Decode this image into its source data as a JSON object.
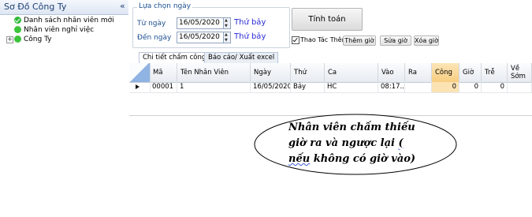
{
  "sidebar": {
    "title": "Sơ Đồ Công Ty",
    "collapse_icon": "«",
    "items": [
      {
        "label": "Danh sách nhân viên mới",
        "icon": "check-circle-icon"
      },
      {
        "label": "Nhân viên nghỉ việc",
        "icon": "green-dot-icon"
      },
      {
        "label": "Công Ty",
        "icon": "green-dot-icon",
        "expander": "+"
      }
    ]
  },
  "filter": {
    "group_title": "Lựa chọn ngày",
    "from_label": "Từ ngày",
    "from_value": "16/05/2020",
    "from_weekday": "Thứ bảy",
    "to_label": "Đến ngày",
    "to_value": "16/05/2020",
    "to_weekday": "Thứ bảy"
  },
  "actions": {
    "calculate": "Tính toán",
    "options_checkbox": "Thao Tác Thêm",
    "options_checked": true,
    "add_time": "Thêm giờ",
    "edit_time": "Sửa giờ",
    "delete_time": "Xóa giờ"
  },
  "tabs": [
    {
      "label": "Chi tiết chấm công",
      "active": true
    },
    {
      "label": "Báo cáo/ Xuất excel",
      "active": false
    }
  ],
  "grid": {
    "columns": [
      "Mã",
      "Tên Nhân Viên",
      "Ngày",
      "Thứ",
      "Ca",
      "Vào",
      "Ra",
      "Công",
      "Giờ",
      "Trễ",
      "Về Sớm"
    ],
    "selected_column": "Công",
    "rows": [
      {
        "ma": "00001",
        "ten": "1",
        "ngay": "16/05/2020",
        "thu": "Bảy",
        "ca": "HC",
        "vao": "08:17...",
        "ra": "",
        "cong": "0",
        "gio": "0",
        "tre": "0",
        "vesom": ""
      }
    ]
  },
  "callout": {
    "line1": "Nhân viên chấm thiếu",
    "line2a": "giờ ra và ngược lại ",
    "line2b": "(",
    "line3a": "nếu",
    "line3b": " không có giờ vào)"
  },
  "colors": {
    "weekday_text": "#2a2ad9",
    "selected_column": "#f7cd80",
    "status_green": "#3cc43c"
  }
}
